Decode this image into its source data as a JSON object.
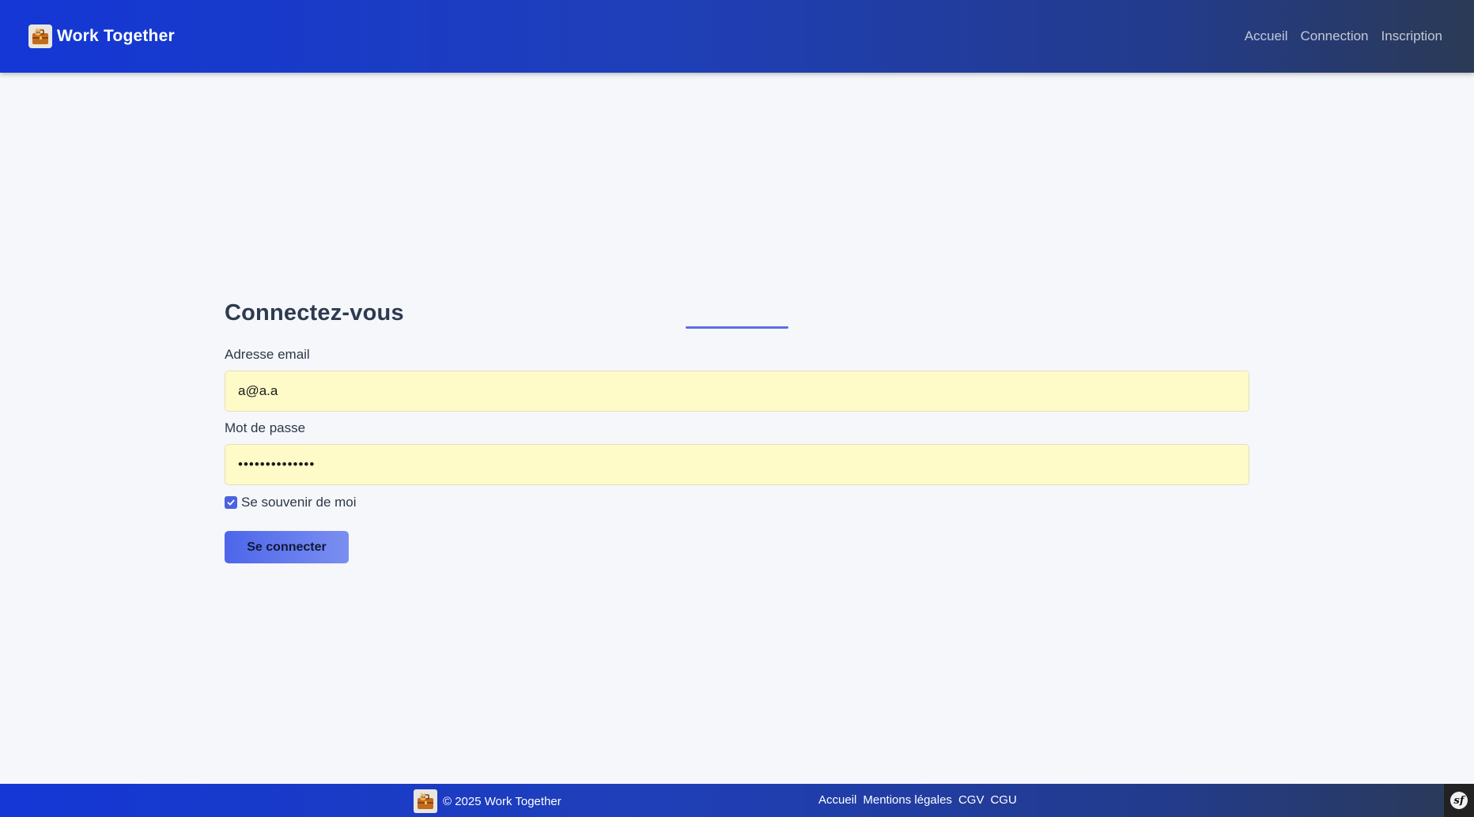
{
  "header": {
    "brand_name": "Work Together",
    "nav": [
      {
        "label": "Accueil"
      },
      {
        "label": "Connection"
      },
      {
        "label": "Inscription"
      }
    ]
  },
  "login": {
    "title": "Connectez-vous",
    "email_label": "Adresse email",
    "email_value": "a@a.a",
    "password_label": "Mot de passe",
    "password_value": "••••••••••••••",
    "remember_label": "Se souvenir de moi",
    "remember_checked": true,
    "submit_label": "Se connecter"
  },
  "footer": {
    "copyright": "© 2025 Work Together",
    "links": [
      {
        "label": "Accueil"
      },
      {
        "label": "Mentions légales"
      },
      {
        "label": "CGV"
      },
      {
        "label": "CGU"
      }
    ],
    "debug_badge": "sf"
  },
  "colors": {
    "header_gradient_start": "#1437d6",
    "header_gradient_end": "#2b3a55",
    "accent": "#4d66ea",
    "input_autofill_bg": "#fefbc8",
    "page_bg": "#f5f7fb"
  },
  "icons": {
    "brand_logo": "briefcase-cat-logo-icon",
    "checkbox": "check-icon",
    "debug": "symfony-icon"
  }
}
